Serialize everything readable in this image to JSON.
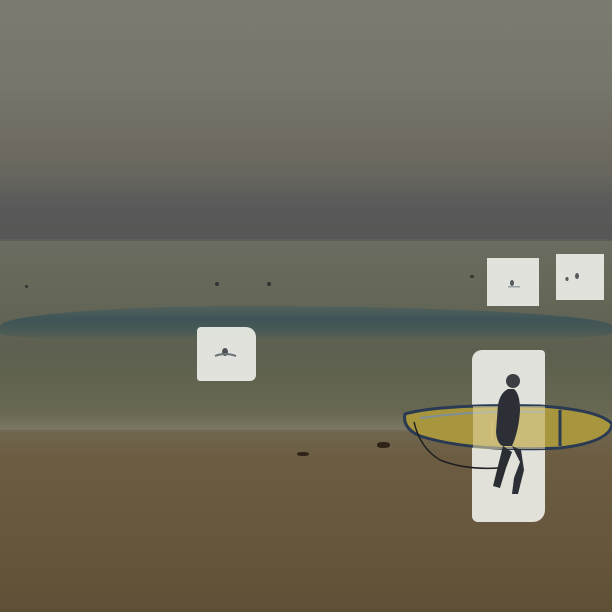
{
  "scene": {
    "description_hidden": "",
    "colors": {
      "sky": "#77776d",
      "sea": "#5f6252",
      "wave": "#3f5457",
      "sand": "#6a5b40",
      "highlight": "#e9eae3",
      "surfboard": "#c9b24a",
      "wetsuit": "#2c3036"
    }
  }
}
